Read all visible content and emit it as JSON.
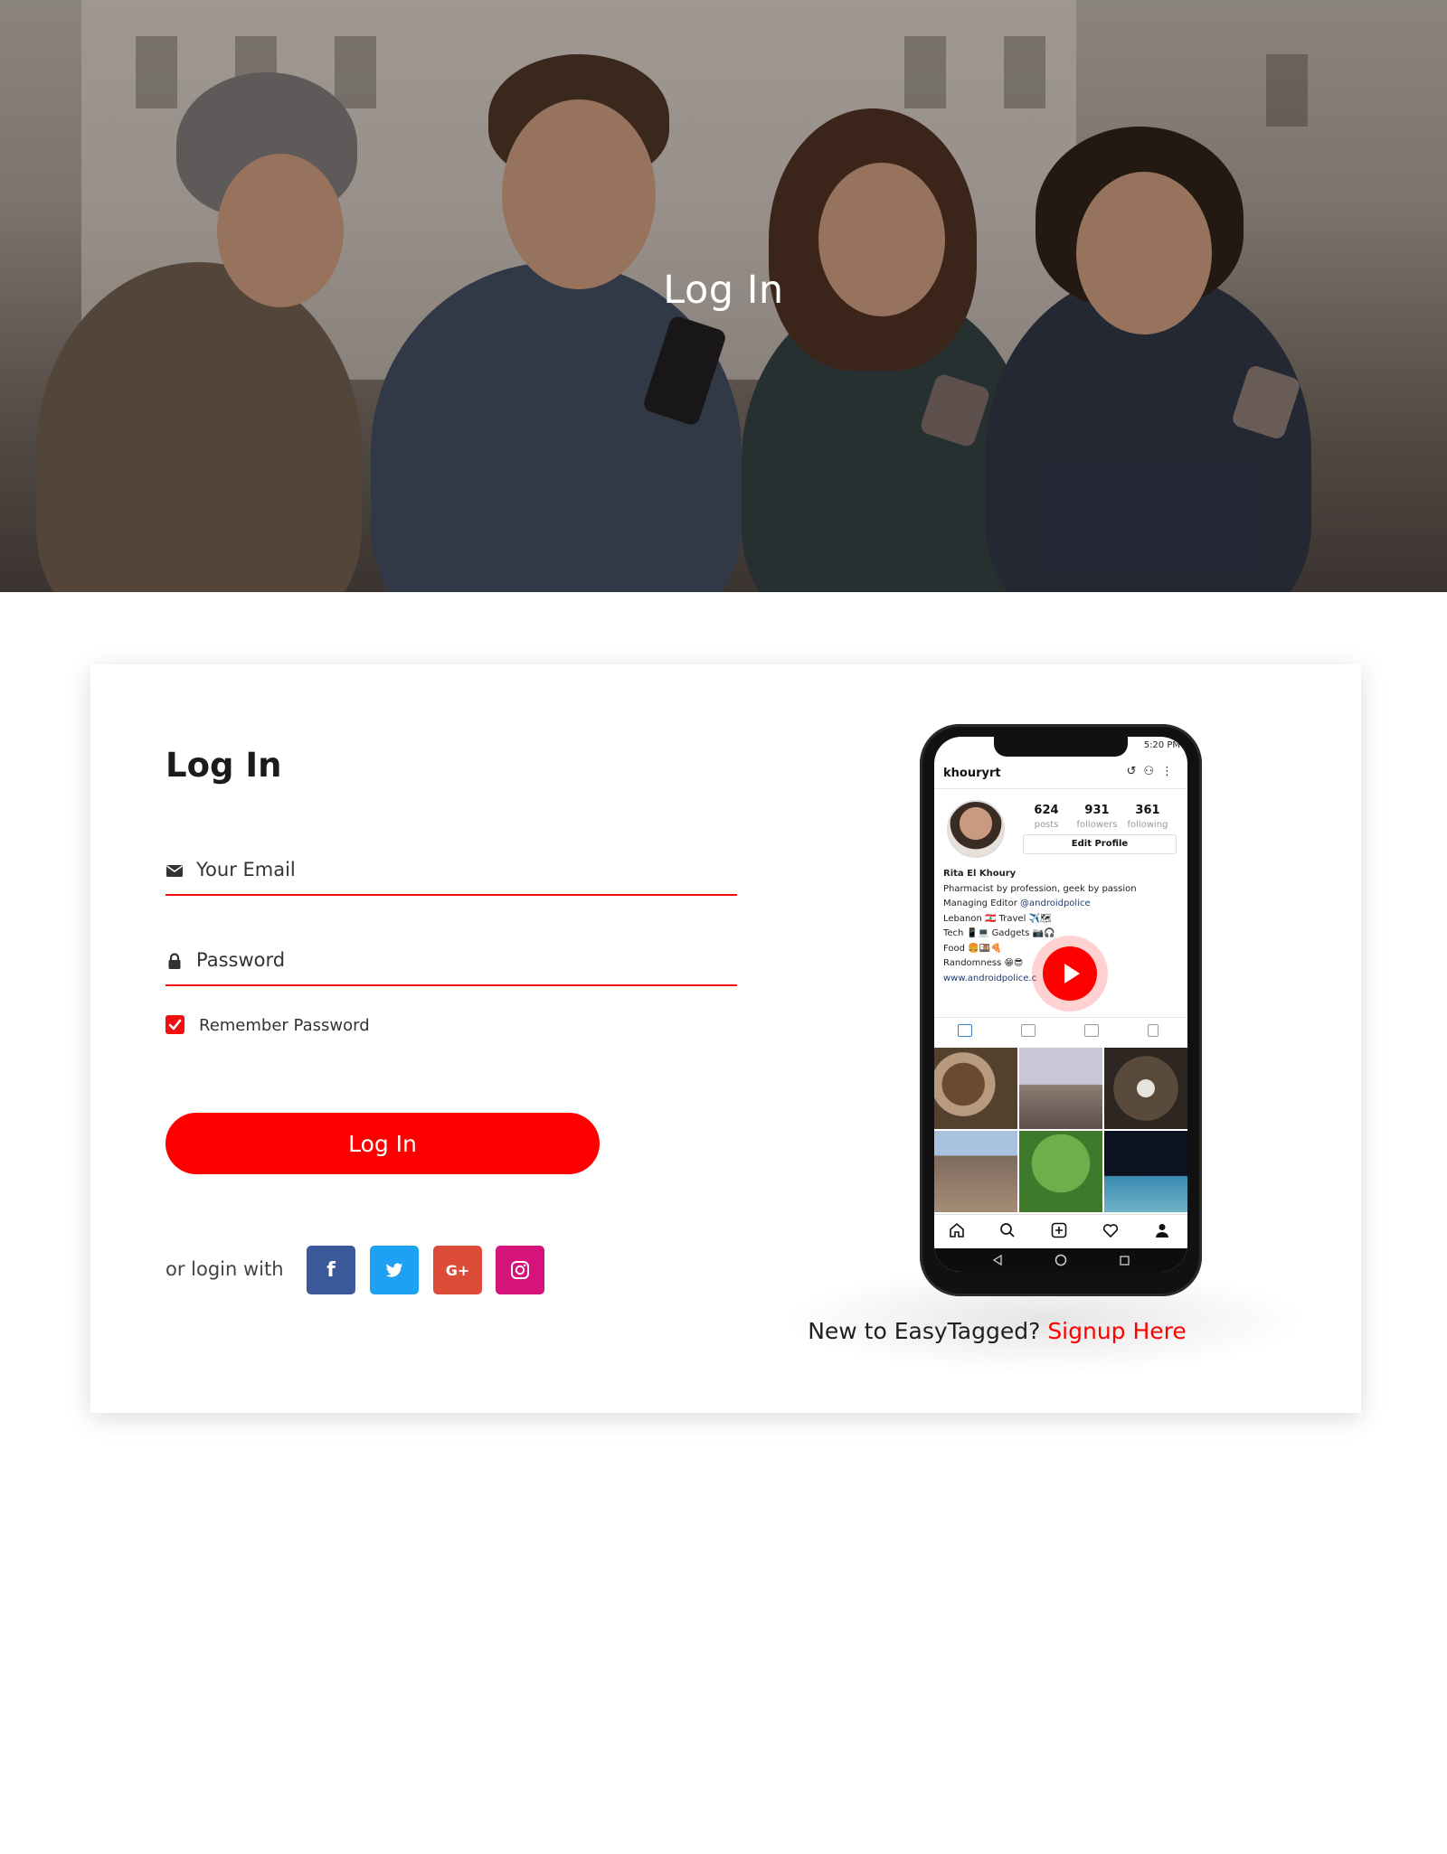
{
  "hero": {
    "title": "Log In"
  },
  "form": {
    "title": "Log In",
    "email_placeholder": "Your Email",
    "password_placeholder": "Password",
    "remember_label": "Remember Password",
    "remember_checked": true,
    "submit_label": "Log In",
    "social_label": "or login with",
    "social": [
      {
        "name": "facebook",
        "glyph": "f",
        "color": "#3b5998"
      },
      {
        "name": "twitter",
        "glyph": "t",
        "color": "#1da1f2"
      },
      {
        "name": "google-plus",
        "glyph": "G+",
        "color": "#dd4b39"
      },
      {
        "name": "instagram",
        "glyph": "instagram-icon",
        "color": "#d6137a"
      }
    ]
  },
  "phone": {
    "status_time": "5:20 PM",
    "username": "khouryrt",
    "stats": [
      {
        "value": "624",
        "label": "posts"
      },
      {
        "value": "931",
        "label": "followers"
      },
      {
        "value": "361",
        "label": "following"
      }
    ],
    "edit_profile": "Edit Profile",
    "bio": {
      "name": "Rita El Khoury",
      "line1": "Pharmacist by profession, geek by passion",
      "line2_prefix": "Managing Editor ",
      "line2_link": "@androidpolice",
      "line3": "Lebanon 🇱🇧 Travel ✈️🗺",
      "line4": "Tech 📱💻 Gadgets 📷🎧",
      "line5": "Food 🍔🍱🍕",
      "line6": "Randomness 😁😎",
      "website": "www.androidpolice.c"
    }
  },
  "signup": {
    "prefix": "New to EasyTagged?",
    "link": "Signup Here"
  },
  "colors": {
    "accent": "#ff0000",
    "underline": "#ef1010"
  }
}
